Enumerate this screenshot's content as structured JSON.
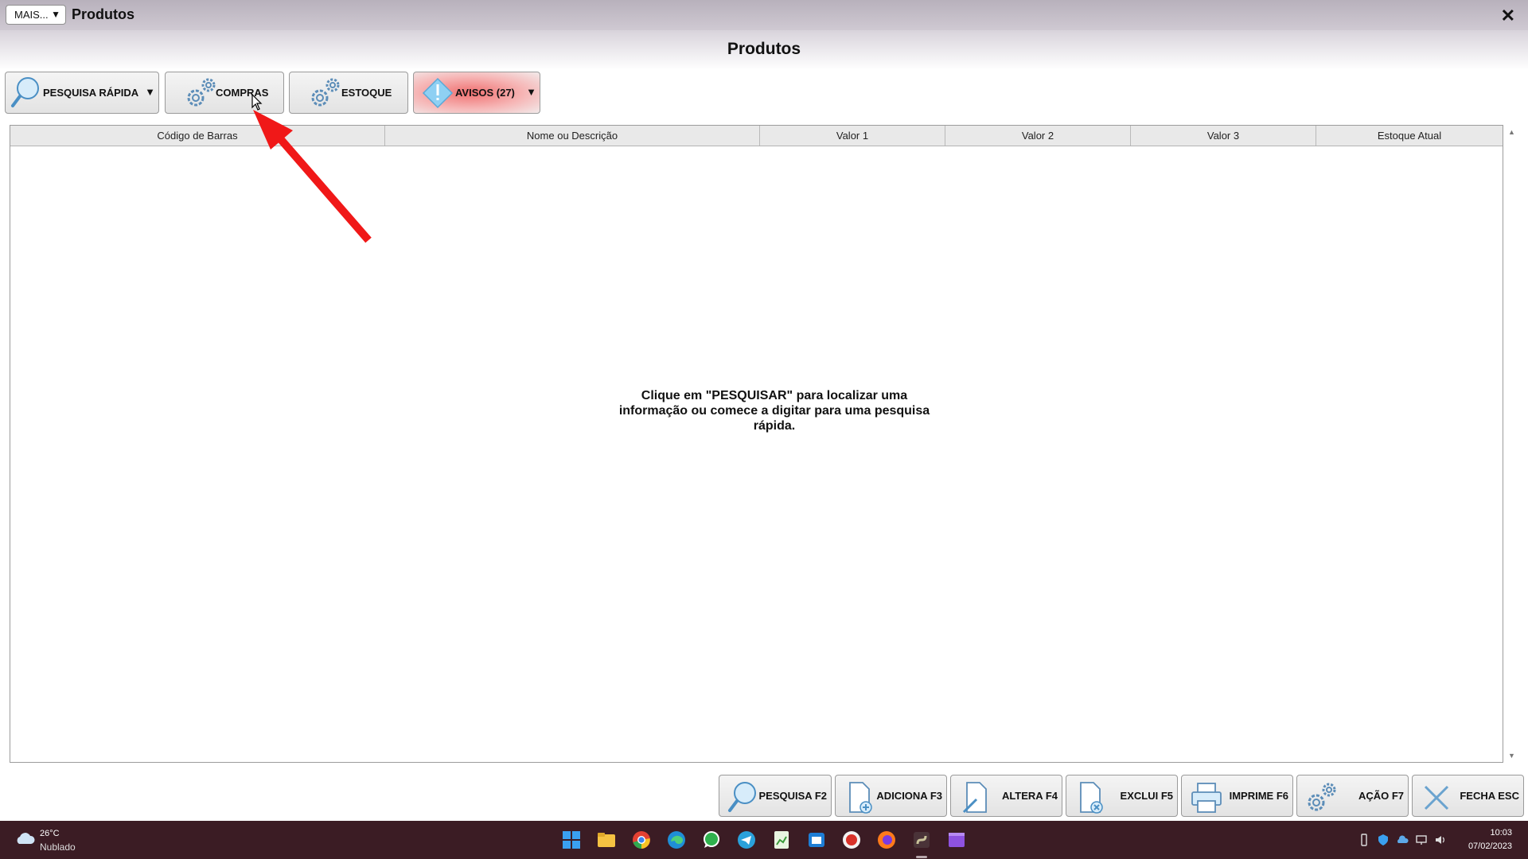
{
  "window": {
    "title": "Produtos",
    "more_label": "MAIS...",
    "close_glyph": "✕"
  },
  "page_title": "Produtos",
  "toolbar": {
    "quick_search_label": "PESQUISA RÁPIDA",
    "purchases_label": "COMPRAS",
    "stock_label": "ESTOQUE",
    "alerts_label": "AVISOS (27)"
  },
  "grid": {
    "columns": [
      "Código de Barras",
      "Nome ou Descrição",
      "Valor 1",
      "Valor 2",
      "Valor 3",
      "Estoque Atual"
    ],
    "empty_message": "Clique em \"PESQUISAR\" para localizar uma informação ou comece a digitar para uma pesquisa rápida."
  },
  "actions": {
    "search": "PESQUISA F2",
    "add": "ADICIONA F3",
    "edit": "ALTERA F4",
    "delete": "EXCLUI F5",
    "print": "IMPRIME F6",
    "action": "AÇÃO F7",
    "close": "FECHA ESC"
  },
  "taskbar": {
    "weather_temp": "26°C",
    "weather_desc": "Nublado",
    "time": "10:03",
    "date": "07/02/2023",
    "apps": [
      "windows-start-icon",
      "file-explorer-icon",
      "chrome-icon",
      "edge-icon",
      "whatsapp-icon",
      "telegram-icon",
      "notepad-icon",
      "outlook-icon",
      "app-red-icon",
      "firefox-icon",
      "erp-app-icon",
      "video-app-icon"
    ]
  },
  "colors": {
    "titlebar": "#c3bcc6",
    "taskbar": "#3b1c24",
    "alerts_accent": "#f08a8a",
    "annotation_arrow": "#f01818"
  }
}
